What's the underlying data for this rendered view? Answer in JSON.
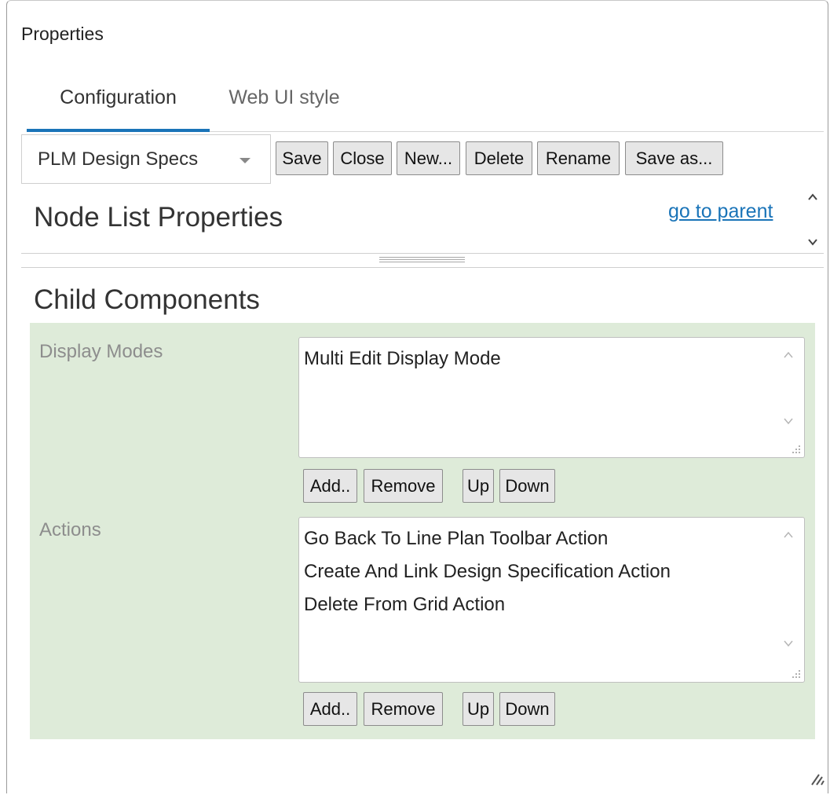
{
  "panel": {
    "title": "Properties"
  },
  "tabs": [
    {
      "label": "Configuration",
      "active": true
    },
    {
      "label": "Web UI style",
      "active": false
    }
  ],
  "toolbar": {
    "config_select": "PLM Design Specs",
    "buttons": [
      "Save",
      "Close",
      "New...",
      "Delete",
      "Rename",
      "Save as..."
    ]
  },
  "node": {
    "title": "Node List Properties",
    "parent_link": "go to parent"
  },
  "child": {
    "title": "Child Components",
    "display_modes": {
      "label": "Display Modes",
      "items": [
        "Multi Edit Display Mode"
      ],
      "buttons": [
        "Add..",
        "Remove",
        "Up",
        "Down"
      ]
    },
    "actions": {
      "label": "Actions",
      "items": [
        "Go Back To Line Plan Toolbar Action",
        "Create And Link Design Specification Action",
        "Delete From Grid Action"
      ],
      "buttons": [
        "Add..",
        "Remove",
        "Up",
        "Down"
      ]
    }
  },
  "colors": {
    "accent": "#1a74b8",
    "section_background": "#deebd9",
    "button_background": "#e6e6e6"
  }
}
